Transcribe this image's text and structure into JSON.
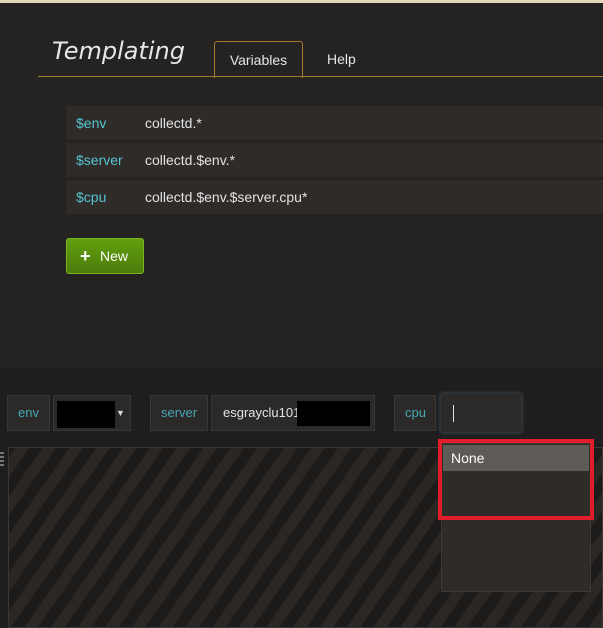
{
  "modal": {
    "title": "Templating",
    "tabs": [
      {
        "label": "Variables",
        "active": true
      },
      {
        "label": "Help",
        "active": false
      }
    ],
    "variables": [
      {
        "name": "$env",
        "query": "collectd.*"
      },
      {
        "name": "$server",
        "query": "collectd.$env.*"
      },
      {
        "name": "$cpu",
        "query": "collectd.$env.$server.cpu*"
      }
    ],
    "new_button": {
      "label": "New",
      "icon": "plus-icon"
    }
  },
  "template_bar": {
    "env": {
      "label": "env",
      "value": ""
    },
    "server": {
      "label": "server",
      "value": "esgrayclu101"
    },
    "cpu": {
      "label": "cpu",
      "value": ""
    }
  },
  "dropdown": {
    "options": [
      "None"
    ]
  },
  "colors": {
    "accent": "#a37a2c",
    "variable_name": "#54c5d1",
    "new_button": "#629e0e",
    "highlight": "#e11d2b"
  }
}
